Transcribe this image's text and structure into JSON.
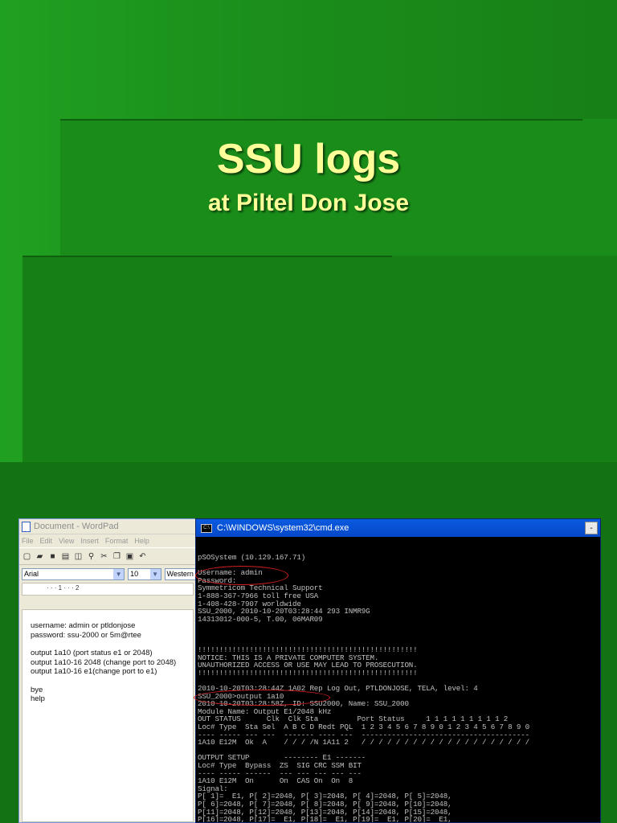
{
  "slide": {
    "title": "SSU logs",
    "subtitle": "at Piltel Don Jose"
  },
  "wordpad": {
    "title": "Document - WordPad",
    "menu": [
      "File",
      "Edit",
      "View",
      "Insert",
      "Format",
      "Help"
    ],
    "font_name": "Arial",
    "font_size": "10",
    "script": "Western",
    "ruler": "· · · 1 · · · 2",
    "lines": [
      "username: admin or ptldonjose",
      "password: ssu-2000 or 5m@rtee",
      "",
      "output 1a10 (port status e1 or 2048)",
      "output 1a10-16 2048 (change port to 2048)",
      "output 1a10-16 e1(change port to e1)",
      "",
      "bye",
      "help"
    ]
  },
  "cmd": {
    "title": "C:\\WINDOWS\\system32\\cmd.exe",
    "min_label": "-",
    "lines": [
      "pSOSystem (10.129.167.71)",
      "",
      "Username: admin",
      "Password:",
      "Symmetricom Technical Support",
      "1-888-367-7966 toll free USA",
      "1-408-428-7907 worldwide",
      "SSU_2000, 2010-10-20T03:28:44 293 INMR9G",
      "14313012-000-5, T.00, 06MAR09",
      "",
      "",
      "",
      "!!!!!!!!!!!!!!!!!!!!!!!!!!!!!!!!!!!!!!!!!!!!!!!!!!!",
      "NOTICE: THIS IS A PRIVATE COMPUTER SYSTEM.",
      "UNAUTHORIZED ACCESS OR USE MAY LEAD TO PROSECUTION.",
      "!!!!!!!!!!!!!!!!!!!!!!!!!!!!!!!!!!!!!!!!!!!!!!!!!!!",
      "",
      "2010-10-20T03:28:44Z 1A02 Rep Log Out, PTLDONJOSE, TELA, level: 4",
      "SSU_2000>output 1a10",
      "2010-10-20T03:28:58Z, ID: SSU2000, Name: SSU_2000",
      "Module Name: Output E1/2048 kHz",
      "OUT STATUS      Clk  Clk Sta         Port Status     1 1 1 1 1 1 1 1 1 2",
      "Loc# Type  Sta Sel  A B C D Redt PQL  1 2 3 4 5 6 7 8 9 0 1 2 3 4 5 6 7 8 9 0",
      "---- ----- --- ---  ------- ---- ---  ---------------------------------------",
      "1A10 E12M  Ok  A    / / / /N 1A11 2   / / / / / / / / / / / / / / / / / / / /",
      "",
      "OUTPUT SETUP        -------- E1 -------",
      "Loc# Type  Bypass  ZS  SIG CRC SSM BIT",
      "---- ----- ------  --- --- --- --- ---",
      "1A10 E12M  On      On  CAS On  On  8",
      "Signal:",
      "P[ 1]=  E1, P[ 2]=2048, P[ 3]=2048, P[ 4]=2048, P[ 5]=2048,",
      "P[ 6]=2048, P[ 7]=2048, P[ 8]=2048, P[ 9]=2048, P[10]=2048,",
      "P[11]=2048, P[12]=2048, P[13]=2048, P[14]=2048, P[15]=2048,",
      "P[16]=2048, P[17]=  E1, P[18]=  E1, P[19]=  E1, P[20]=  E1,"
    ]
  }
}
